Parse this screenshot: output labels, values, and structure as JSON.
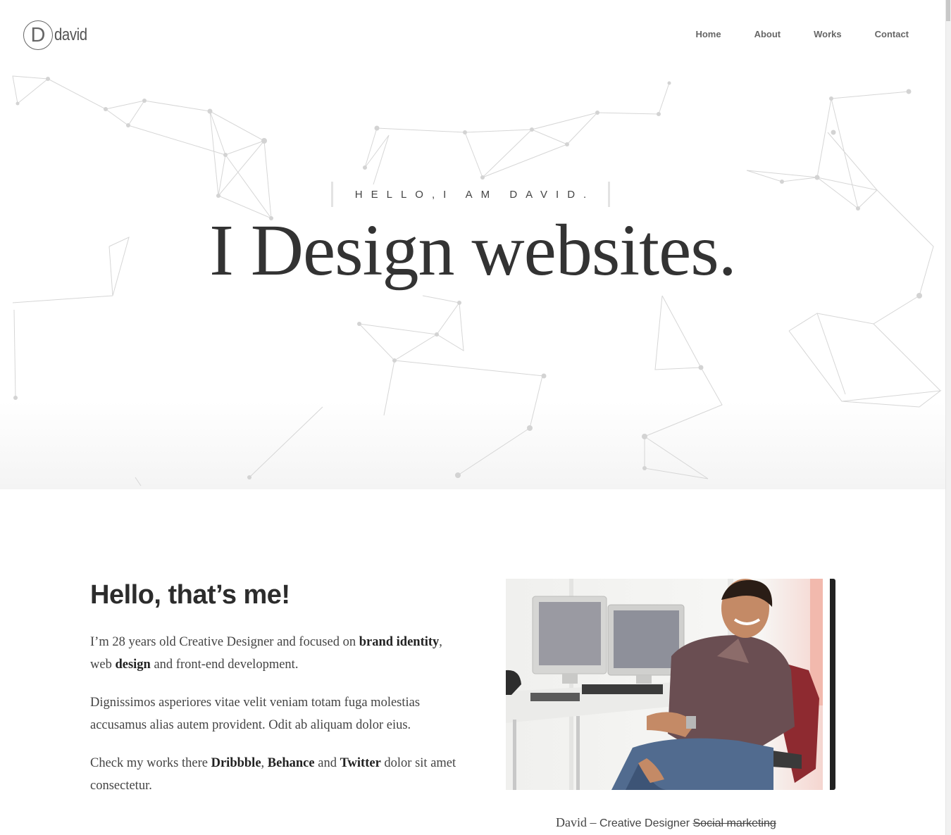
{
  "header": {
    "logo_letter": "D",
    "logo_text": "david",
    "nav": [
      {
        "label": "Home"
      },
      {
        "label": "About"
      },
      {
        "label": "Works"
      },
      {
        "label": "Contact"
      }
    ]
  },
  "hero": {
    "kicker": "HELLO,I AM DAVID.",
    "title": "I Design websites."
  },
  "about": {
    "heading": "Hello, that’s me!",
    "p1": {
      "a": "I’m 28 years old Creative Designer and focused on ",
      "b": "brand identity",
      "c": ", web ",
      "d": "design",
      "e": " and front-end development."
    },
    "p2": "Dignissimos asperiores vitae velit veniam totam fuga molestias accusamus alias autem provident. Odit ab aliquam dolor eius.",
    "p3": {
      "a": "Check my works there ",
      "b": "Dribbble",
      "c": ", ",
      "d": "Behance",
      "e": " and ",
      "f": "Twitter",
      "g": " dolor sit amet consectetur."
    },
    "photo_icon": "person-at-desk-photo",
    "caption": {
      "name": "David",
      "sep": " – ",
      "role": "Creative Designer ",
      "struck": "Social marketing"
    }
  },
  "colors": {
    "text": "#333333",
    "nav": "#666666",
    "network": "#cccccc",
    "photo_edge": "#222222"
  }
}
